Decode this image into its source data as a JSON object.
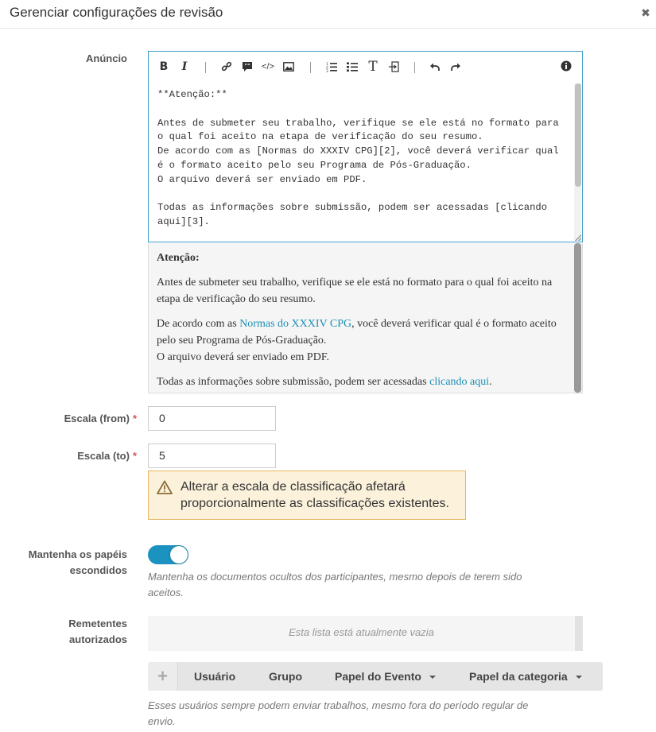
{
  "modal": {
    "title": "Gerenciar configurações de revisão",
    "close_icon": "close-icon"
  },
  "announcement": {
    "label": "Anúncio",
    "toolbar": [
      {
        "name": "bold",
        "icon": "bold-icon"
      },
      {
        "name": "italic",
        "icon": "italic-icon"
      },
      {
        "name": "link",
        "icon": "link-icon"
      },
      {
        "name": "quote",
        "icon": "quote-icon"
      },
      {
        "name": "code",
        "icon": "code-icon"
      },
      {
        "name": "image",
        "icon": "image-icon"
      },
      {
        "name": "ordered-list",
        "icon": "ordered-list-icon"
      },
      {
        "name": "unordered-list",
        "icon": "unordered-list-icon"
      },
      {
        "name": "heading",
        "icon": "heading-icon"
      },
      {
        "name": "horizontal-rule",
        "icon": "horizontal-rule-icon"
      },
      {
        "name": "undo",
        "icon": "undo-icon"
      },
      {
        "name": "redo",
        "icon": "redo-icon"
      },
      {
        "name": "help",
        "icon": "info-icon"
      }
    ],
    "source_text": "**Atenção:**\n\nAntes de submeter seu trabalho, verifique se ele está no formato para o qual foi aceito na etapa de verificação do seu resumo.\nDe acordo com as [Normas do XXXIV CPG][2], você deverá verificar qual é o formato aceito pelo seu Programa de Pós-Graduação.\nO arquivo deverá ser enviado em PDF.\n\nTodas as informações sobre submissão, podem ser acessadas [clicando aqui][3].",
    "preview": {
      "heading": "Atenção:",
      "p1": "Antes de submeter seu trabalho, verifique se ele está no formato para o qual foi aceito na etapa de verificação do seu resumo.",
      "p2_prefix": "De acordo com as ",
      "p2_link": "Normas do XXXIV CPG",
      "p2_suffix": ", você deverá verificar qual é o formato aceito pelo seu Programa de Pós-Graduação.",
      "p3": "O arquivo deverá ser enviado em PDF.",
      "p4_prefix": "Todas as informações sobre submissão, podem ser acessadas ",
      "p4_link": "clicando aqui",
      "p4_suffix": "."
    }
  },
  "scale_from": {
    "label": "Escala (from)",
    "required_mark": "*",
    "value": "0"
  },
  "scale_to": {
    "label": "Escala (to)",
    "required_mark": "*",
    "value": "5"
  },
  "warning": {
    "icon": "warning-icon",
    "text": "Alterar a escala de classificação afetará proporcionalmente as classificações existentes."
  },
  "hidden_papers": {
    "label_line1": "Mantenha os papéis",
    "label_line2": "escondidos",
    "enabled": true,
    "help_line1": "Mantenha os documentos ocultos dos participantes, mesmo depois de terem sido",
    "help_line2": "aceitos."
  },
  "authorized_submitters": {
    "label_line1": "Remetentes",
    "label_line2": "autorizados",
    "empty_text": "Esta lista está atualmente vazia",
    "add_icon": "plus-icon",
    "add_symbol": "+",
    "tabs": [
      {
        "label": "Usuário",
        "dropdown": false
      },
      {
        "label": "Grupo",
        "dropdown": false
      },
      {
        "label": "Papel do Evento",
        "dropdown": true
      },
      {
        "label": "Papel da categoria",
        "dropdown": true
      }
    ],
    "help_line1": "Esses usuários sempre podem enviar trabalhos, mesmo fora do período regular de",
    "help_line2": "envio."
  },
  "colors": {
    "accent": "#1b92c0",
    "link": "#1a8fb5",
    "warning_bg": "#fcf2dc",
    "warning_border": "#e8b55d",
    "required": "#d9534f"
  }
}
